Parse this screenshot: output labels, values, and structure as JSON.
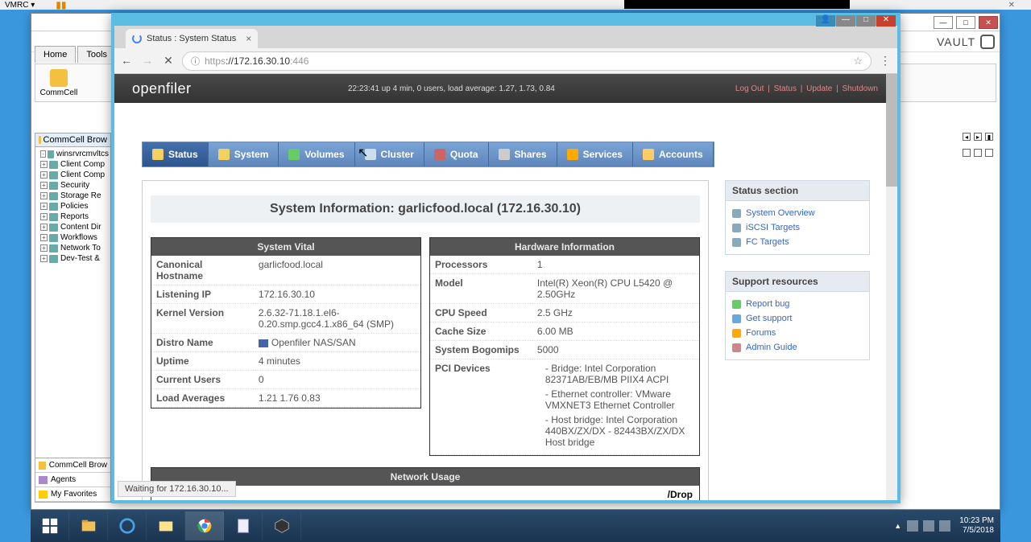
{
  "vmrc": {
    "label": "VMRC ▾"
  },
  "host": {
    "tabs": [
      "Home",
      "Tools"
    ],
    "toolbar": {
      "commcell": "CommCell"
    },
    "logo": "VAULT",
    "tree_header": "CommCell Brow",
    "tree": [
      "winsrvrcmvltcs",
      "Client Comp",
      "Client Comp",
      "Security",
      "Storage Re",
      "Policies",
      "Reports",
      "Content Dir",
      "Workflows",
      "Network To",
      "Dev-Test &"
    ],
    "bottom": [
      "CommCell Brow",
      "Agents",
      "My Favorites"
    ]
  },
  "browser": {
    "tab_title": "Status : System Status",
    "url_scheme": "https",
    "url_host": "://172.16.30.10",
    "url_port": ":446",
    "status_text": "Waiting for 172.16.30.10..."
  },
  "openfiler": {
    "logo": "openfiler",
    "uptime_bar": "22:23:41 up 4 min, 0 users, load average: 1.27, 1.73, 0.84",
    "links": [
      "Log Out",
      "Status",
      "Update",
      "Shutdown"
    ],
    "nav": [
      "Status",
      "System",
      "Volumes",
      "Cluster",
      "Quota",
      "Shares",
      "Services",
      "Accounts"
    ],
    "sys_info_title": "System Information: garlicfood.local (172.16.30.10)",
    "vital": {
      "title": "System Vital",
      "rows": {
        "canonical_hostname_lbl": "Canonical Hostname",
        "canonical_hostname": "garlicfood.local",
        "listening_ip_lbl": "Listening IP",
        "listening_ip": "172.16.30.10",
        "kernel_lbl": "Kernel Version",
        "kernel": "2.6.32-71.18.1.el6-0.20.smp.gcc4.1.x86_64 (SMP)",
        "distro_lbl": "Distro Name",
        "distro": "Openfiler NAS/SAN",
        "uptime_lbl": "Uptime",
        "uptime": "4 minutes",
        "users_lbl": "Current Users",
        "users": "0",
        "load_lbl": "Load Averages",
        "load": "1.21 1.76 0.83"
      }
    },
    "hw": {
      "title": "Hardware Information",
      "rows": {
        "proc_lbl": "Processors",
        "proc": "1",
        "model_lbl": "Model",
        "model": "Intel(R) Xeon(R) CPU L5420 @ 2.50GHz",
        "cpuspeed_lbl": "CPU Speed",
        "cpuspeed": "2.5 GHz",
        "cache_lbl": "Cache Size",
        "cache": "6.00 MB",
        "bogo_lbl": "System Bogomips",
        "bogo": "5000",
        "pci_lbl": "PCI Devices",
        "pci": [
          "Bridge: Intel Corporation 82371AB/EB/MB PIIX4 ACPI",
          "Ethernet controller: VMware VMXNET3 Ethernet Controller",
          "Host bridge: Intel Corporation 440BX/ZX/DX - 82443BX/ZX/DX Host bridge"
        ]
      }
    },
    "net_usage_title": "Network Usage",
    "net_usage_partial": "/Drop",
    "side_status": {
      "title": "Status section",
      "items": [
        "System Overview",
        "iSCSI Targets",
        "FC Targets"
      ]
    },
    "side_support": {
      "title": "Support resources",
      "items": [
        "Report bug",
        "Get support",
        "Forums",
        "Admin Guide"
      ]
    }
  },
  "tray": {
    "time": "10:23 PM",
    "date": "7/5/2018"
  }
}
